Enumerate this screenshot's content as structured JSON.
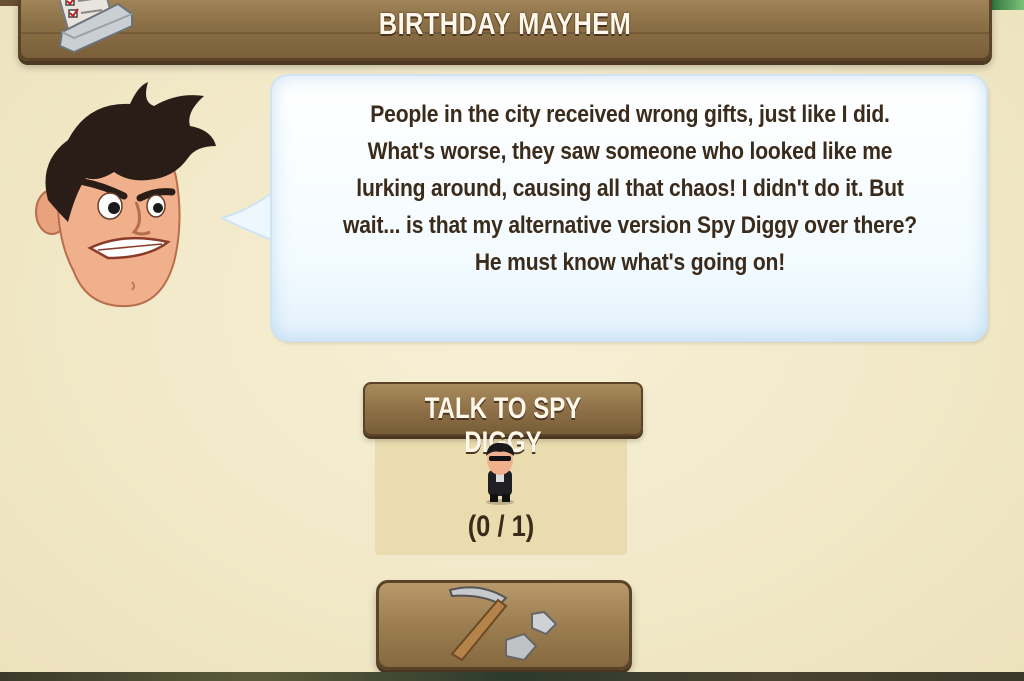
{
  "header": {
    "title": "BIRTHDAY MAYHEM",
    "icon": "quest-list-icon"
  },
  "dialog": {
    "speaker_icon": "diggy-face-icon",
    "text": "People in the city received wrong gifts, just like I did. What's worse, they saw someone who looked like me lurking around, causing all that chaos! I didn't do it. But wait... is that my alternative version Spy Diggy over there? He must know what's going on!"
  },
  "task": {
    "label": "TALK TO SPY DIGGY",
    "icon": "spy-diggy-icon",
    "progress": "(0 / 1)",
    "progress_current": 0,
    "progress_total": 1
  },
  "dig_button": {
    "icon": "pickaxe-icon"
  },
  "colors": {
    "wood": "#8d7148",
    "parchment": "#f3ebcd",
    "bubble": "#f3fbff",
    "text": "#3b2b1b"
  }
}
